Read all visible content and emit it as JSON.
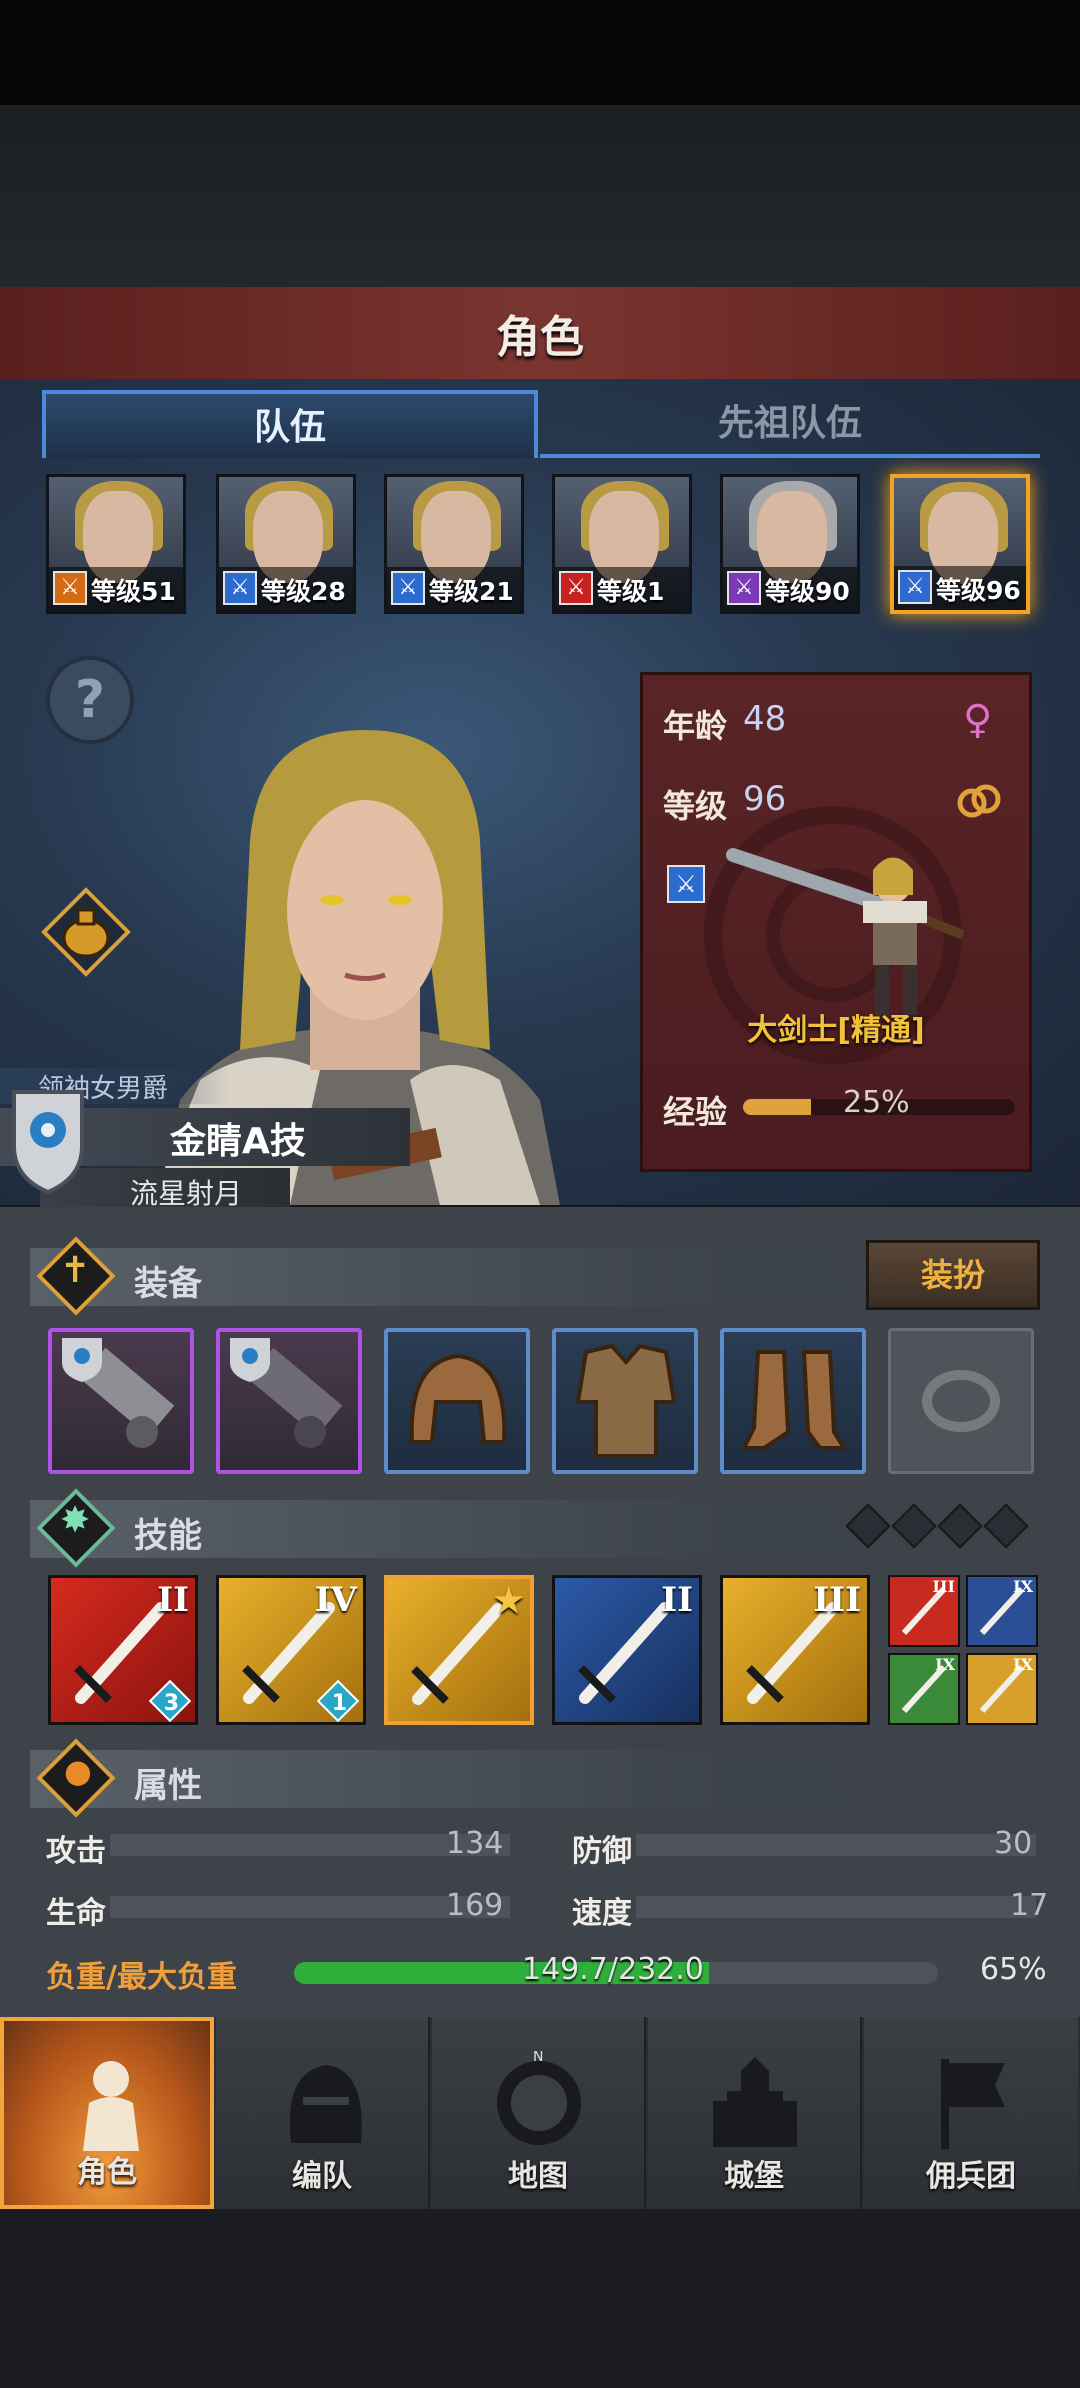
{
  "header": {
    "title": "角色"
  },
  "tabs": [
    {
      "label": "队伍",
      "active": true
    },
    {
      "label": "先祖队伍",
      "active": false
    }
  ],
  "roster": [
    {
      "level_text": "等级51",
      "class_color": "orange",
      "hair": "blond"
    },
    {
      "level_text": "等级28",
      "class_color": "blue",
      "hair": "blond"
    },
    {
      "level_text": "等级21",
      "class_color": "blue",
      "hair": "blond"
    },
    {
      "level_text": "等级1",
      "class_color": "red",
      "hair": "blond"
    },
    {
      "level_text": "等级90",
      "class_color": "purple",
      "hair": "grey"
    },
    {
      "level_text": "等级96",
      "class_color": "blue",
      "hair": "blond",
      "selected": true
    }
  ],
  "character": {
    "title": "领袖女男爵",
    "name": "金睛A技",
    "subtitle": "流星射月",
    "age_label": "年龄",
    "age": "48",
    "level_label": "等级",
    "level": "96",
    "class_name": "大剑士[精通]",
    "exp_label": "经验",
    "exp_text": "25%",
    "exp_fraction": 0.25
  },
  "sections": {
    "equipment": "装备",
    "outfit_button": "装扮",
    "skills": "技能",
    "attributes": "属性"
  },
  "skills": [
    {
      "rank": "II",
      "badge": "3",
      "color": "red"
    },
    {
      "rank": "IV",
      "badge": "1",
      "color": "gold"
    },
    {
      "rank": "",
      "badge": "",
      "color": "gold-star"
    },
    {
      "rank": "II",
      "badge": "",
      "color": "blue"
    },
    {
      "rank": "III",
      "badge": "",
      "color": "gold"
    }
  ],
  "mini_skills": [
    {
      "rank": "III",
      "color": "red"
    },
    {
      "rank": "IX",
      "color": "blue"
    },
    {
      "rank": "IX",
      "color": "green"
    },
    {
      "rank": "IX",
      "color": "gold"
    }
  ],
  "attributes": {
    "attack_label": "攻击",
    "attack": "134",
    "defense_label": "防御",
    "defense": "30",
    "hp_label": "生命",
    "hp": "169",
    "speed_label": "速度",
    "speed": "17",
    "load_label": "负重/最大负重",
    "load": "149.7/232.0",
    "load_percent": "65%",
    "load_fraction": 0.645
  },
  "nav": [
    {
      "label": "角色",
      "active": true
    },
    {
      "label": "编队",
      "active": false
    },
    {
      "label": "地图",
      "active": false
    },
    {
      "label": "城堡",
      "active": false
    },
    {
      "label": "佣兵团",
      "active": false
    }
  ],
  "colors": {
    "accent": "#f3a322",
    "tab_blue": "#4c8ad8",
    "exp": "#e0a23a",
    "load": "#2fae3c"
  }
}
